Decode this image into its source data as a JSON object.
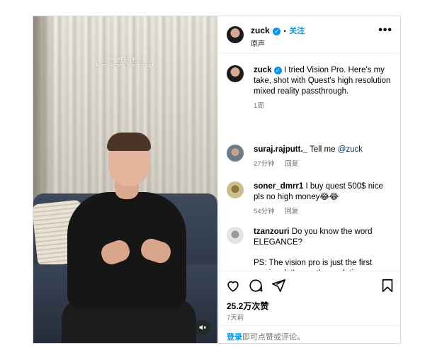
{
  "video": {
    "overlay_line1": "Shot with Quest 3",
    "overlay_line2": "Mixed Reality Passthrough",
    "mute_icon": "speaker-muted-icon"
  },
  "header": {
    "username": "zuck",
    "verified_mark": "✓",
    "separator": "•",
    "follow_label": "关注",
    "subtitle": "原声",
    "more_label": "•••"
  },
  "caption": {
    "username": "zuck",
    "text": "I tried Vision Pro. Here's my take, shot with Quest's high resolution mixed reality passthrough.",
    "time": "1周"
  },
  "comments": [
    {
      "username": "suraj.rajputt._",
      "text": "Tell me",
      "mention": "@zuck",
      "time": "27分钟",
      "reply": "回复"
    },
    {
      "username": "soner_dmrr1",
      "text": "I buy quest 500$ nice pls no high money😂😂",
      "time": "54分钟",
      "reply": "回复"
    },
    {
      "username": "tzanzouri",
      "text": "Do you know the word ELEGANCE?",
      "text2": "PS: The vision pro is just the first version, let's see the evolution"
    }
  ],
  "actions": {
    "icons": [
      "heart-icon",
      "comment-icon",
      "share-icon",
      "bookmark-icon"
    ],
    "likes": "25.2万次赞",
    "posted": "7天前"
  },
  "login_prompt": {
    "link": "登录",
    "text": "即可点赞或评论。"
  },
  "colors": {
    "accent": "#0095f6",
    "muted_text": "#737373",
    "border": "#dbdbdb"
  }
}
